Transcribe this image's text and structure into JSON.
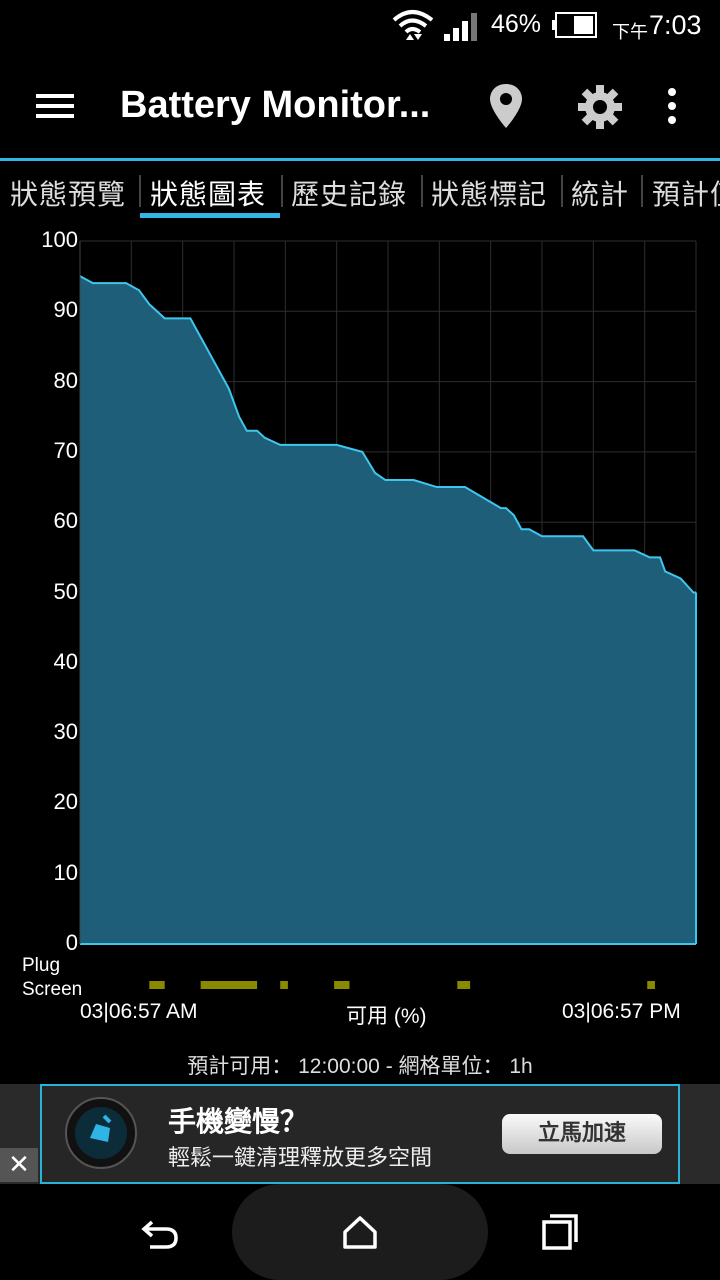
{
  "status_bar": {
    "battery_percent": "46%",
    "am_pm": "下午",
    "time": "7:03"
  },
  "app_bar": {
    "title": "Battery Monitor...",
    "icons": [
      "menu-icon",
      "location-pin-icon",
      "gear-icon",
      "overflow-menu-icon"
    ]
  },
  "tabs": [
    {
      "label": "狀態預覽",
      "active": false
    },
    {
      "label": "狀態圖表",
      "active": true
    },
    {
      "label": "歷史記錄",
      "active": false
    },
    {
      "label": "狀態標記",
      "active": false
    },
    {
      "label": "統計",
      "active": false
    },
    {
      "label": "預計值",
      "active": false
    }
  ],
  "chart_data": {
    "type": "area",
    "ylim": [
      0,
      100
    ],
    "y_ticks": [
      "100",
      "90",
      "80",
      "70",
      "60",
      "50",
      "40",
      "30",
      "20",
      "10",
      "0"
    ],
    "xlim": [
      0,
      12
    ],
    "x_start_label": "03|06:57 AM",
    "x_end_label": "03|06:57 PM",
    "xlabel": "可用 (%)",
    "grid": true,
    "fill_color": "#1e5e78",
    "line_color": "#3ec6ee",
    "series": [
      {
        "x": [
          0,
          0.25,
          0.9,
          1.15,
          1.35,
          1.5,
          1.65,
          2.15,
          2.3,
          2.6,
          2.9,
          3.1,
          3.25,
          3.45,
          3.6,
          3.9,
          4.0,
          4.3,
          4.5,
          5.0,
          5.5,
          5.75,
          5.95,
          6.5,
          6.95,
          7.4,
          7.5,
          8.2,
          8.3,
          8.45,
          8.6,
          8.75,
          9.0,
          9.8,
          10.0,
          10.8,
          11.1,
          11.2,
          11.3,
          11.4,
          11.7,
          11.95,
          12.0
        ],
        "y": [
          95,
          94,
          94,
          93,
          91,
          90,
          89,
          89,
          87,
          83,
          79,
          75,
          73,
          73,
          72,
          71,
          71,
          71,
          71,
          71,
          70,
          67,
          66,
          66,
          65,
          65,
          65,
          62,
          62,
          61,
          59,
          59,
          58,
          58,
          56,
          56,
          55,
          55,
          55,
          53,
          52,
          50,
          50
        ]
      }
    ],
    "plug_label": "Plug",
    "screen_label": "Screen",
    "screen_color": "#8a8a00",
    "screen_on_intervals": [
      [
        1.35,
        1.65
      ],
      [
        2.35,
        3.45
      ],
      [
        3.9,
        4.05
      ],
      [
        4.95,
        5.25
      ],
      [
        7.35,
        7.6
      ],
      [
        11.05,
        11.2
      ]
    ]
  },
  "footer_info": {
    "text": "預計可用： 12:00:00 - 網格單位： 1h"
  },
  "ad": {
    "title": "手機變慢？",
    "subtitle": "輕鬆一鍵清理釋放更多空間",
    "button": "立馬加速",
    "close": "✕"
  },
  "nav": {
    "icons": [
      "back-icon",
      "home-icon",
      "recents-icon"
    ]
  }
}
